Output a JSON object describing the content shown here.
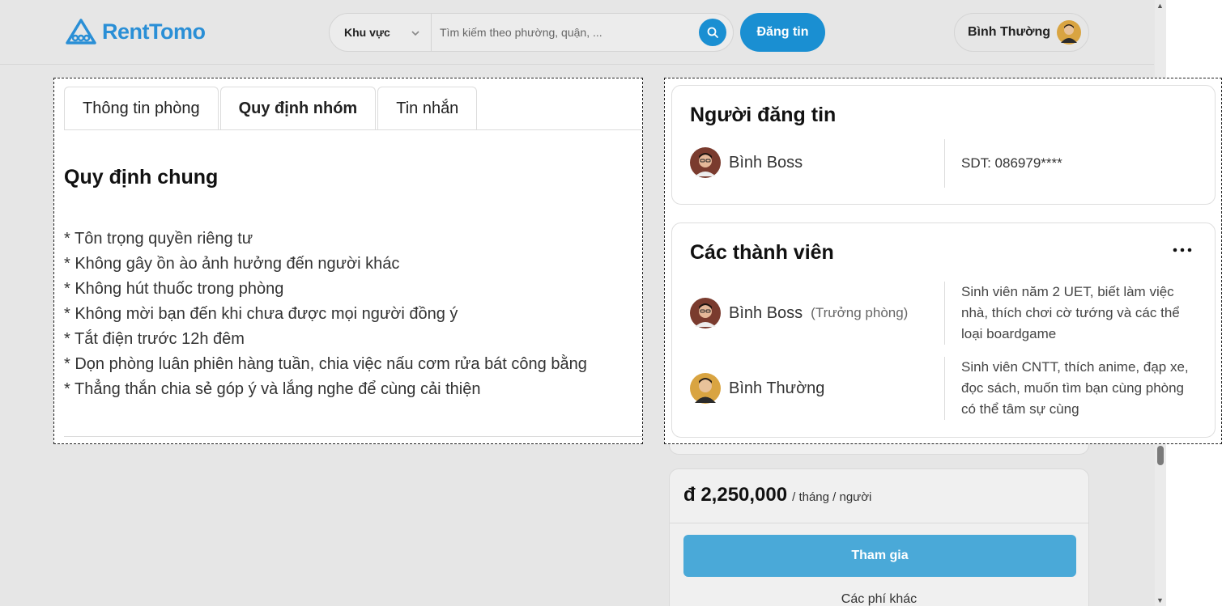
{
  "brand": {
    "name": "RentTomo",
    "color": "#2a8fd6"
  },
  "header": {
    "region_label": "Khu vực",
    "search_placeholder": "Tìm kiếm theo phường, quận, ...",
    "post_button": "Đăng tin",
    "user_name": "Bình Thường"
  },
  "tabs": [
    {
      "label": "Thông tin phòng"
    },
    {
      "label": "Quy định nhóm",
      "active": true
    },
    {
      "label": "Tin nhắn"
    }
  ],
  "rules": {
    "title": "Quy định chung",
    "items": [
      "* Tôn trọng quyền riêng tư",
      "* Không gây ồn ào ảnh hưởng đến người khác",
      "* Không hút thuốc trong phòng",
      "* Không mời bạn đến khi chưa được mọi người đồng ý",
      "* Tắt điện trước 12h đêm",
      "* Dọn phòng luân phiên hàng tuần, chia việc nấu cơm rửa bát công bằng",
      "* Thẳng thắn chia sẻ góp ý và lắng nghe để cùng cải thiện"
    ]
  },
  "poster": {
    "title": "Người đăng tin",
    "name": "Bình Boss",
    "phone": "SDT: 086979****"
  },
  "members": {
    "title": "Các thành viên",
    "list": [
      {
        "name": "Bình Boss",
        "role": "(Trưởng phòng)",
        "bio": "Sinh viên năm 2 UET, biết làm việc nhà, thích chơi cờ tướng và các thể loại boardgame"
      },
      {
        "name": "Bình Thường",
        "role": "",
        "bio": "Sinh viên CNTT, thích anime, đạp xe, đọc sách, muốn tìm bạn cùng phòng có thể tâm sự cùng"
      }
    ]
  },
  "pricing": {
    "amount": "đ 2,250,000",
    "unit": "/ tháng / người",
    "join_button": "Tham gia",
    "other_fees": "Các phí khác"
  },
  "colors": {
    "primary": "#1a8fd2",
    "join_button": "#4aa9d8",
    "page_bg": "#e6e6e6"
  }
}
